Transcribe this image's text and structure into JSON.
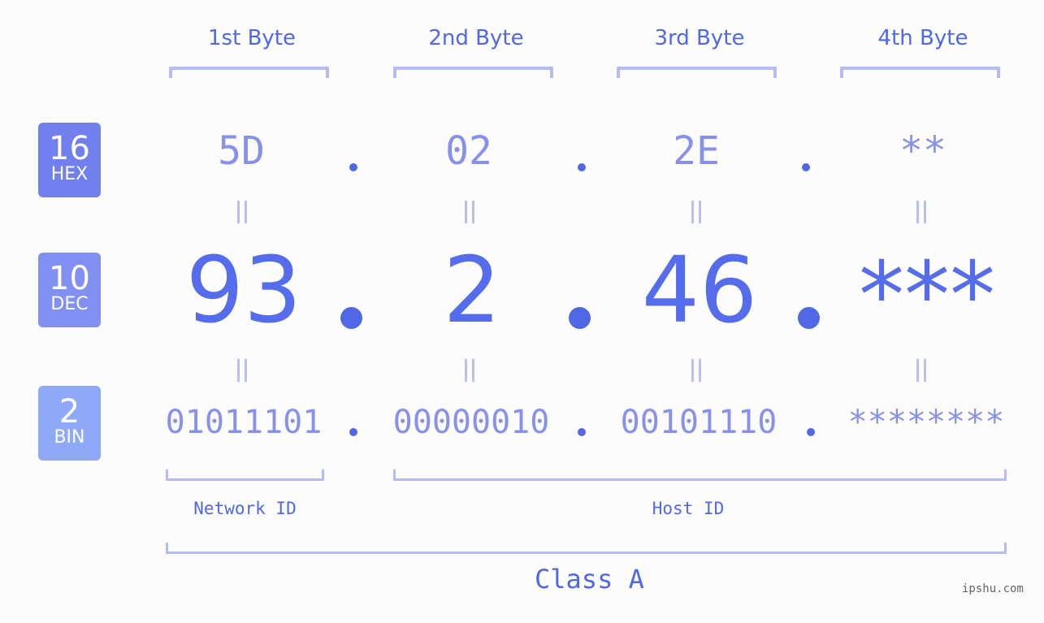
{
  "byte_headers": [
    "1st Byte",
    "2nd Byte",
    "3rd Byte",
    "4th Byte"
  ],
  "badges": [
    {
      "num": "16",
      "label": "HEX",
      "color": "#7180ec"
    },
    {
      "num": "10",
      "label": "DEC",
      "color": "#8190f2"
    },
    {
      "num": "2",
      "label": "BIN",
      "color": "#8fa8f8"
    }
  ],
  "hex": [
    "5D",
    "02",
    "2E",
    "**"
  ],
  "dec": [
    "93",
    "2",
    "46",
    "***"
  ],
  "bin": [
    "01011101",
    "00000010",
    "00101110",
    "********"
  ],
  "separator": ".",
  "network_id_label": "Network ID",
  "host_id_label": "Host ID",
  "class_label": "Class A",
  "watermark": "ipshu.com",
  "colors": {
    "accent": "#5168e6",
    "light_value": "#8791ec",
    "bracket": "#b3bcf7",
    "background": "#fbfcfb"
  }
}
